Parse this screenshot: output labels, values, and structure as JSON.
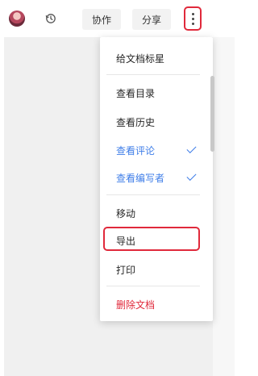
{
  "toolbar": {
    "avatar_icon": "user-avatar",
    "history_icon": "history-clock-icon",
    "collab_label": "协作",
    "share_label": "分享",
    "more_icon": "more-vertical-icon"
  },
  "menu": {
    "items": [
      {
        "label": "给文档标星"
      },
      {
        "label": "查看目录"
      },
      {
        "label": "查看历史"
      },
      {
        "label": "查看评论",
        "checked": true
      },
      {
        "label": "查看编写者",
        "checked": true
      },
      {
        "label": "移动"
      },
      {
        "label": "导出",
        "highlighted": true
      },
      {
        "label": "打印"
      },
      {
        "label": "删除文档",
        "danger": true
      }
    ]
  },
  "colors": {
    "accent_blue": "#3f7ee8",
    "danger_red": "#e0293b",
    "highlight_red": "#e0293b"
  }
}
